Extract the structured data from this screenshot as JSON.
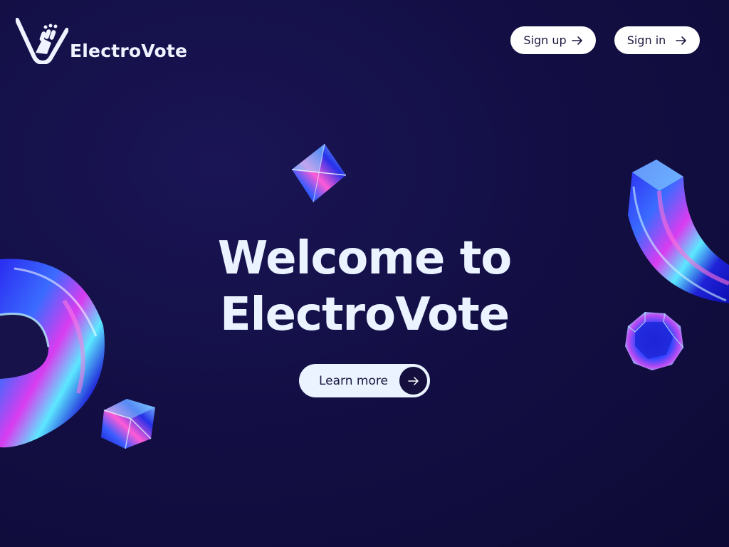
{
  "brand": {
    "name": "ElectroVote",
    "logo_icon": "voting-hand-icon"
  },
  "nav": {
    "signup_label": "Sign up",
    "signin_label": "Sign in",
    "arrow_icon": "arrow-right-icon"
  },
  "hero": {
    "title_line1": "Welcome to",
    "title_line2": "ElectroVote",
    "cta_label": "Learn more"
  },
  "colors": {
    "background": "#130f45",
    "heading": "#eaf3ff",
    "button_bg": "#ffffff",
    "button_text": "#1b1740",
    "accent_dark": "#140f3d"
  }
}
